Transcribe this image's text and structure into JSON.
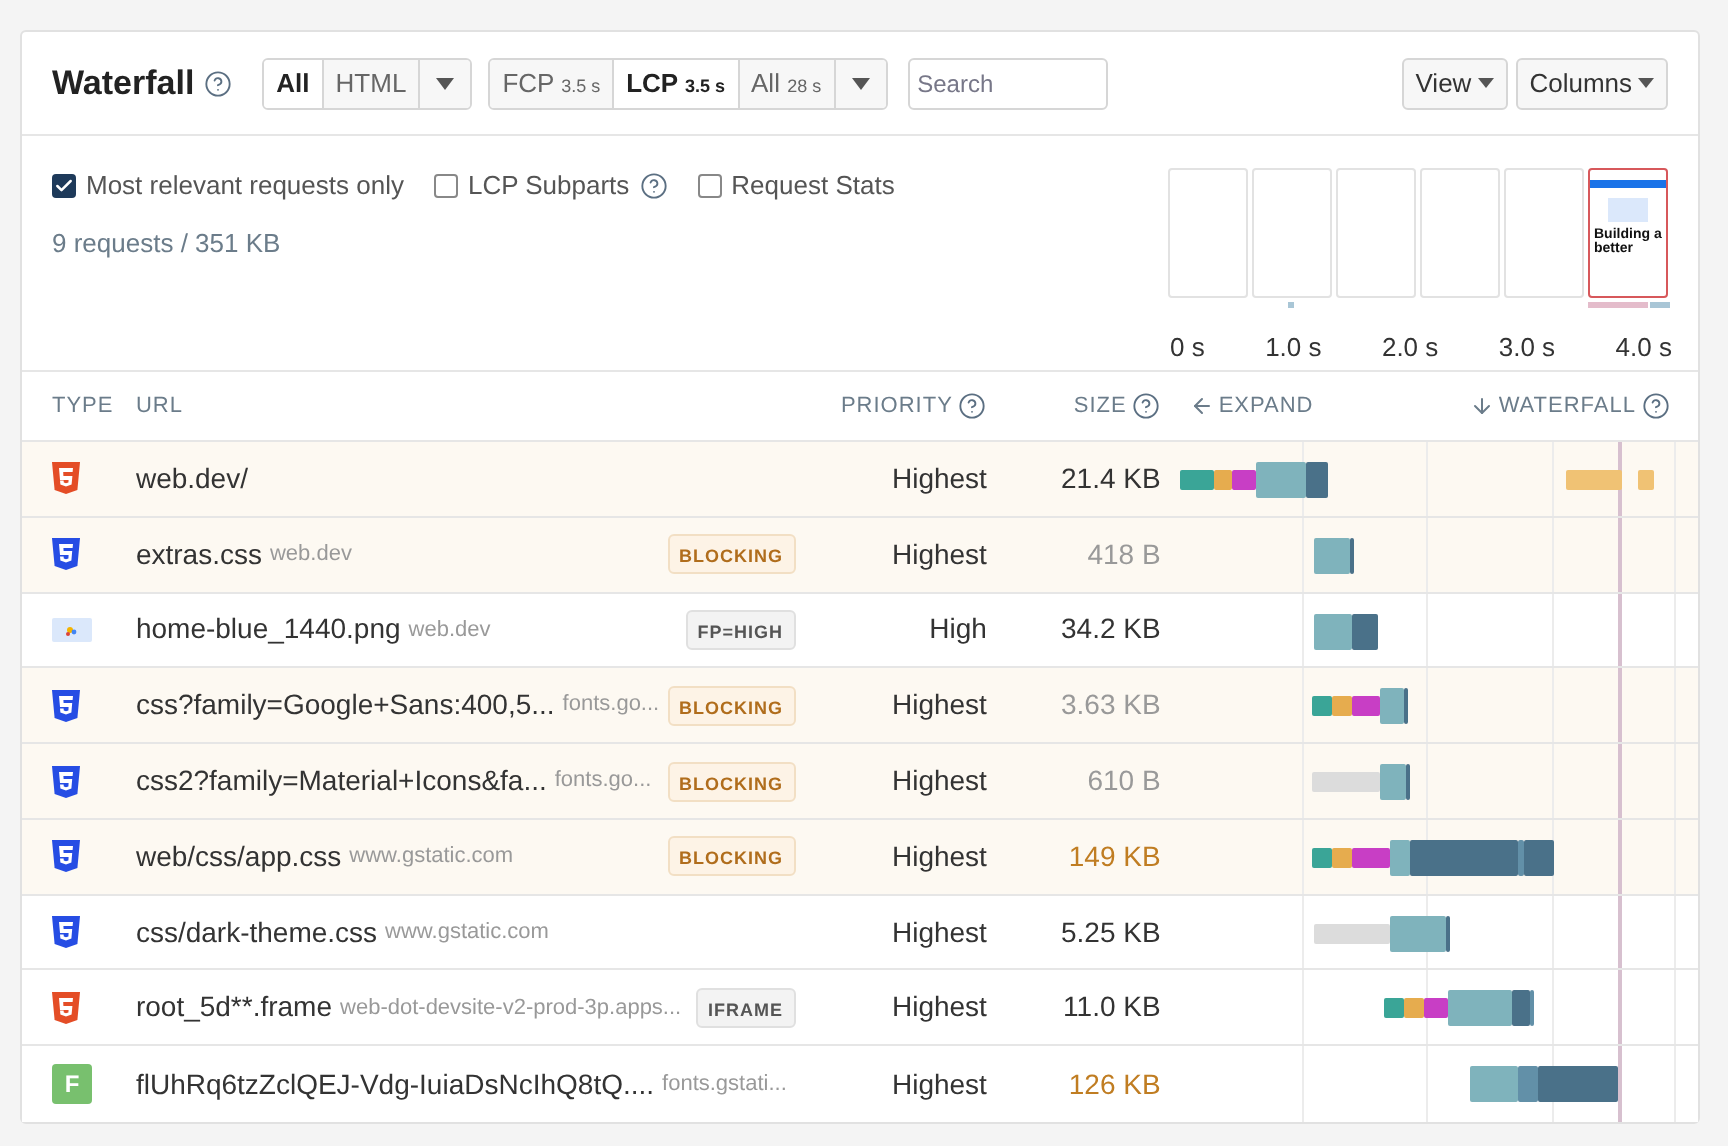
{
  "header": {
    "title": "Waterfall",
    "type_filter": [
      {
        "label": "All",
        "selected": true
      },
      {
        "label": "HTML",
        "selected": false
      }
    ],
    "time_filter": [
      {
        "label": "FCP",
        "value": "3.5 s",
        "selected": false
      },
      {
        "label": "LCP",
        "value": "3.5 s",
        "selected": true
      },
      {
        "label": "All",
        "value": "28 s",
        "selected": false
      }
    ],
    "search": {
      "placeholder": "Search"
    },
    "buttons": [
      "View",
      "Columns"
    ]
  },
  "options": [
    {
      "label": "Most relevant requests only",
      "checked": true
    },
    {
      "label": "LCP Subparts",
      "checked": false,
      "help": true
    },
    {
      "label": "Request Stats",
      "checked": false
    }
  ],
  "summary": "9 requests / 351 KB",
  "filmstrip": {
    "frames": [
      {
        "selected": false
      },
      {
        "selected": false
      },
      {
        "selected": false
      },
      {
        "selected": false
      },
      {
        "selected": false
      },
      {
        "selected": true,
        "caption": "Building a better"
      }
    ],
    "times": [
      "0 s",
      "1.0 s",
      "2.0 s",
      "3.0 s",
      "4.0 s"
    ]
  },
  "table": {
    "columns": [
      {
        "label": "TYPE"
      },
      {
        "label": "URL"
      },
      {
        "label": "PRIORITY",
        "help": true
      },
      {
        "label": "SIZE",
        "help": true
      }
    ],
    "expand": "EXPAND",
    "waterfall": "WATERFALL",
    "rows": [
      {
        "kind": "html",
        "url": "web.dev/",
        "priority": "Highest",
        "size": "21.4 KB",
        "size_muted": false,
        "size_large": false,
        "highlighted": true
      },
      {
        "kind": "css",
        "url": "extras.css",
        "host": "web.dev",
        "badge": {
          "text": "BLOCKING",
          "kind": "warning"
        },
        "priority": "Highest",
        "size": "418 B",
        "size_muted": true,
        "size_large": false,
        "highlighted": true
      },
      {
        "kind": "image",
        "url": "home-blue_1440.png",
        "host": "web.dev",
        "badge": {
          "text": "FP=HIGH",
          "kind": "neutral"
        },
        "priority": "High",
        "size": "34.2 KB",
        "size_muted": false,
        "size_large": false,
        "highlighted": false
      },
      {
        "kind": "css",
        "url": "css?family=Google+Sans:400,5...",
        "host": "fonts.go...",
        "badge": {
          "text": "BLOCKING",
          "kind": "warning"
        },
        "priority": "Highest",
        "size": "3.63 KB",
        "size_muted": true,
        "size_large": false,
        "highlighted": true
      },
      {
        "kind": "css",
        "url": "css2?family=Material+Icons&fa...",
        "host": "fonts.go...",
        "badge": {
          "text": "BLOCKING",
          "kind": "warning"
        },
        "priority": "Highest",
        "size": "610 B",
        "size_muted": true,
        "size_large": false,
        "highlighted": true
      },
      {
        "kind": "css",
        "url": "web/css/app.css",
        "host": "www.gstatic.com",
        "badge": {
          "text": "BLOCKING",
          "kind": "warning"
        },
        "priority": "Highest",
        "size": "149 KB",
        "size_muted": false,
        "size_large": true,
        "highlighted": true
      },
      {
        "kind": "css",
        "url": "css/dark-theme.css",
        "host": "www.gstatic.com",
        "priority": "Highest",
        "size": "5.25 KB",
        "size_muted": false,
        "size_large": false,
        "highlighted": false
      },
      {
        "kind": "html",
        "url": "root_5d**.frame",
        "host": "web-dot-devsite-v2-prod-3p.apps...",
        "badge": {
          "text": "IFRAME",
          "kind": "neutral"
        },
        "priority": "Highest",
        "size": "11.0 KB",
        "size_muted": false,
        "size_large": false,
        "highlighted": false
      },
      {
        "kind": "font",
        "url": "flUhRq6tzZclQEJ-Vdg-IuiaDsNcIhQ8tQ....",
        "host": "fonts.gstati...",
        "priority": "Highest",
        "size": "126 KB",
        "size_muted": false,
        "size_large": true,
        "highlighted": false,
        "icon_letter": "F"
      }
    ]
  }
}
